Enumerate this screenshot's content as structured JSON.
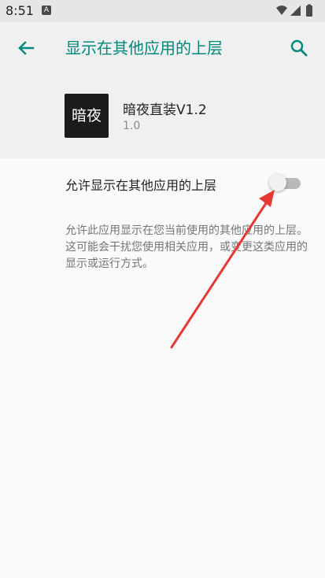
{
  "status_bar": {
    "time": "8:51",
    "notification_icon": "A"
  },
  "header": {
    "title": "显示在其他应用的上层",
    "back_icon": "arrow-back-icon",
    "search_icon": "search-icon"
  },
  "app": {
    "icon_text": "暗夜",
    "name": "暗夜直装V1.2",
    "version": "1.0"
  },
  "setting": {
    "label": "允许显示在其他应用的上层",
    "enabled": false
  },
  "description": "允许此应用显示在您当前使用的其他应用的上层。这可能会干扰您使用相关应用，或变更这类应用的显示或运行方式。",
  "colors": {
    "accent": "#00897b",
    "annotation_arrow": "#e53935"
  }
}
